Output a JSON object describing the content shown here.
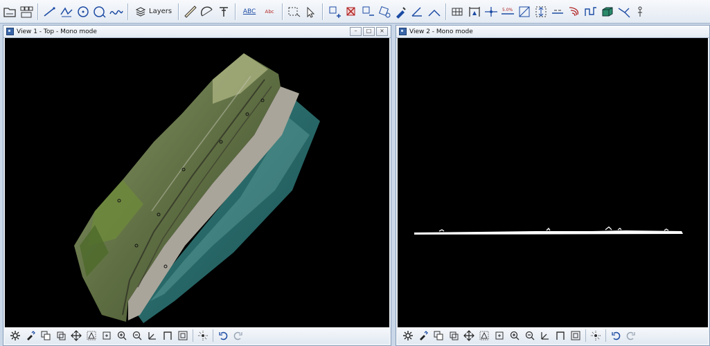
{
  "toolbar": {
    "layers_label": "Layers",
    "abc_label": "ABC",
    "abc_small_label": "Abc"
  },
  "view1": {
    "title": "View 1 - Top - Mono mode"
  },
  "view2": {
    "title": "View 2 - Mono mode"
  },
  "view_toolbar": {
    "icons": [
      "gear-icon",
      "brush-icon",
      "copy-icon",
      "paste-icon",
      "pan-icon",
      "zoom-extents-icon",
      "zoom-window-icon",
      "zoom-in-icon",
      "zoom-out-icon",
      "axis-icon",
      "profile-icon",
      "fit-icon",
      "explode-icon",
      "undo-view-icon",
      "redo-view-icon"
    ]
  },
  "colors": {
    "accent": "#3a66a8",
    "canvas": "#000000",
    "chrome": "#c9d7e8"
  }
}
